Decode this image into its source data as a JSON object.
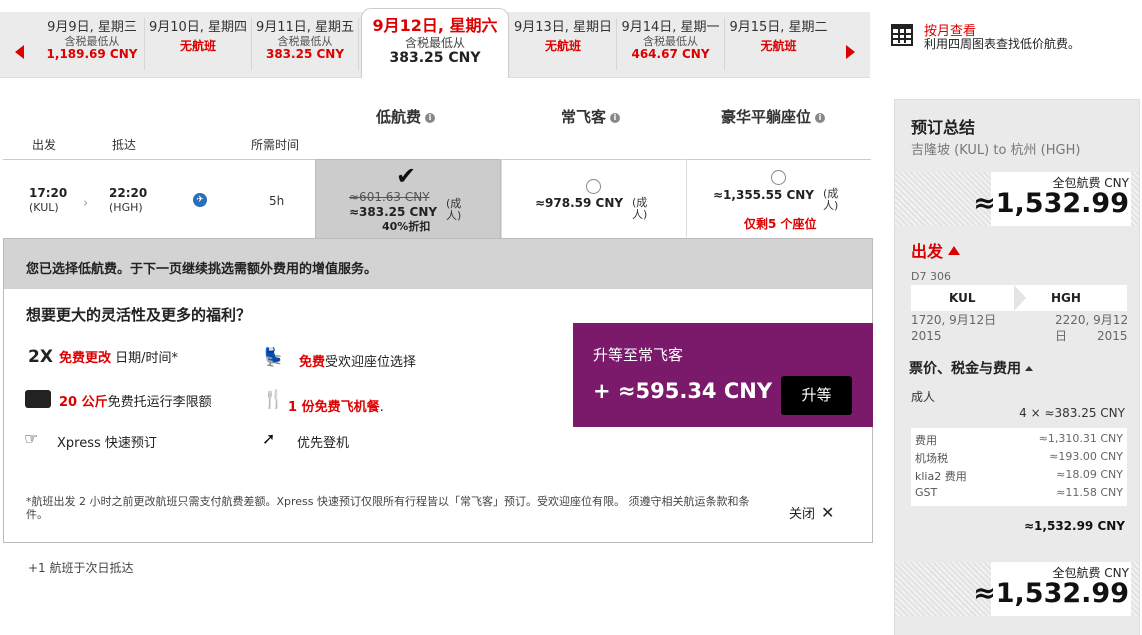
{
  "date_strip": {
    "days": [
      {
        "label": "9月9日, 星期三",
        "sub": "含税最低从",
        "price": "1,189.69 CNY"
      },
      {
        "label": "9月10日, 星期四",
        "status": "无航班"
      },
      {
        "label": "9月11日, 星期五",
        "sub": "含税最低从",
        "price": "383.25 CNY"
      },
      {
        "label": "9月12日, 星期六",
        "sub": "含税最低从",
        "price": "383.25 CNY",
        "selected": true
      },
      {
        "label": "9月13日, 星期日",
        "status": "无航班"
      },
      {
        "label": "9月14日, 星期一",
        "sub": "含税最低从",
        "price": "464.67 CNY"
      },
      {
        "label": "9月15日, 星期二",
        "status": "无航班"
      }
    ],
    "prev_icon": "arrow-left-icon",
    "next_icon": "arrow-right-icon"
  },
  "month_view": {
    "title": "按月查看",
    "desc": "利用四周图表查找低价航费。",
    "icon": "calendar-icon"
  },
  "fare_types": {
    "low": "低航费",
    "frequent": "常飞客",
    "premium": "豪华平躺座位"
  },
  "columns": {
    "depart": "出发",
    "arrive": "抵达",
    "duration": "所需时间"
  },
  "flight": {
    "dep_time": "17:20",
    "dep_code": "(KUL)",
    "arr_time": "22:20",
    "arr_code": "(HGH)",
    "duration": "5h",
    "low_fare": {
      "original": "≈601.63 CNY",
      "price": "≈383.25 CNY",
      "pax": "(成人)",
      "discount": "40%折扣"
    },
    "frequent_fare": {
      "price": "≈978.59 CNY",
      "pax": "(成人)"
    },
    "premium_fare": {
      "price": "≈1,355.55 CNY",
      "pax": "(成人)",
      "seats_left": "仅剩5 个座位"
    }
  },
  "upsell": {
    "header": "您已选择低航费。于下一页继续挑选需额外费用的增值服务。",
    "title": "想要更大的灵活性及更多的福利？",
    "benefits": {
      "change_big": "2X",
      "change_red": "免费更改",
      "change_rest": "日期/时间*",
      "seat_red": "免费",
      "seat_rest": "受欢迎座位选择",
      "baggage_red": "20 公斤",
      "baggage_rest": "免费托运行李限额",
      "meal_red": "1 份免费飞机餐",
      "meal_rest": ".",
      "xpress": "Xpress 快速预订",
      "boarding": "优先登机"
    },
    "upgrade_title": "升等至常飞客",
    "upgrade_price": "+ ≈595.34 CNY",
    "upgrade_button": "升等",
    "footnote": "*航班出发 2 小时之前更改航班只需支付航费差额。Xpress 快速预订仅限所有行程皆以「常飞客」预订。受欢迎座位有限。 须遵守相关航运条款和条件。",
    "close_label": "关闭",
    "close_icon": "close-icon"
  },
  "next_day_note": "+1 航班于次日抵达",
  "summary": {
    "title": "预订总结",
    "route": "吉隆坡 (KUL) to 杭州 (HGH)",
    "total_label": "全包航费 CNY",
    "total_value": "≈1,532.99",
    "departure": "出发",
    "flight_no": "D7 306",
    "from_code": "KUL",
    "to_code": "HGH",
    "from_time": "1720, 9月12日",
    "from_year": "2015",
    "to_time": "2220, 9月12日",
    "to_year": "2015",
    "fees_title": "票价、税金与费用",
    "adult": "成人",
    "multiplier": "4 × ≈383.25 CNY",
    "fees": [
      {
        "label": "费用",
        "value": "≈1,310.31 CNY"
      },
      {
        "label": "机场税",
        "value": "≈193.00 CNY"
      },
      {
        "label": "klia2 费用",
        "value": "≈18.09 CNY"
      },
      {
        "label": "GST",
        "value": "≈11.58 CNY"
      }
    ],
    "sum": "≈1,532.99 CNY",
    "total_label_2": "全包航费 CNY",
    "total_value_2": "≈1,532.99"
  },
  "colors": {
    "accent_red": "#dd0000",
    "upgrade_purple": "#7b1a6a"
  }
}
